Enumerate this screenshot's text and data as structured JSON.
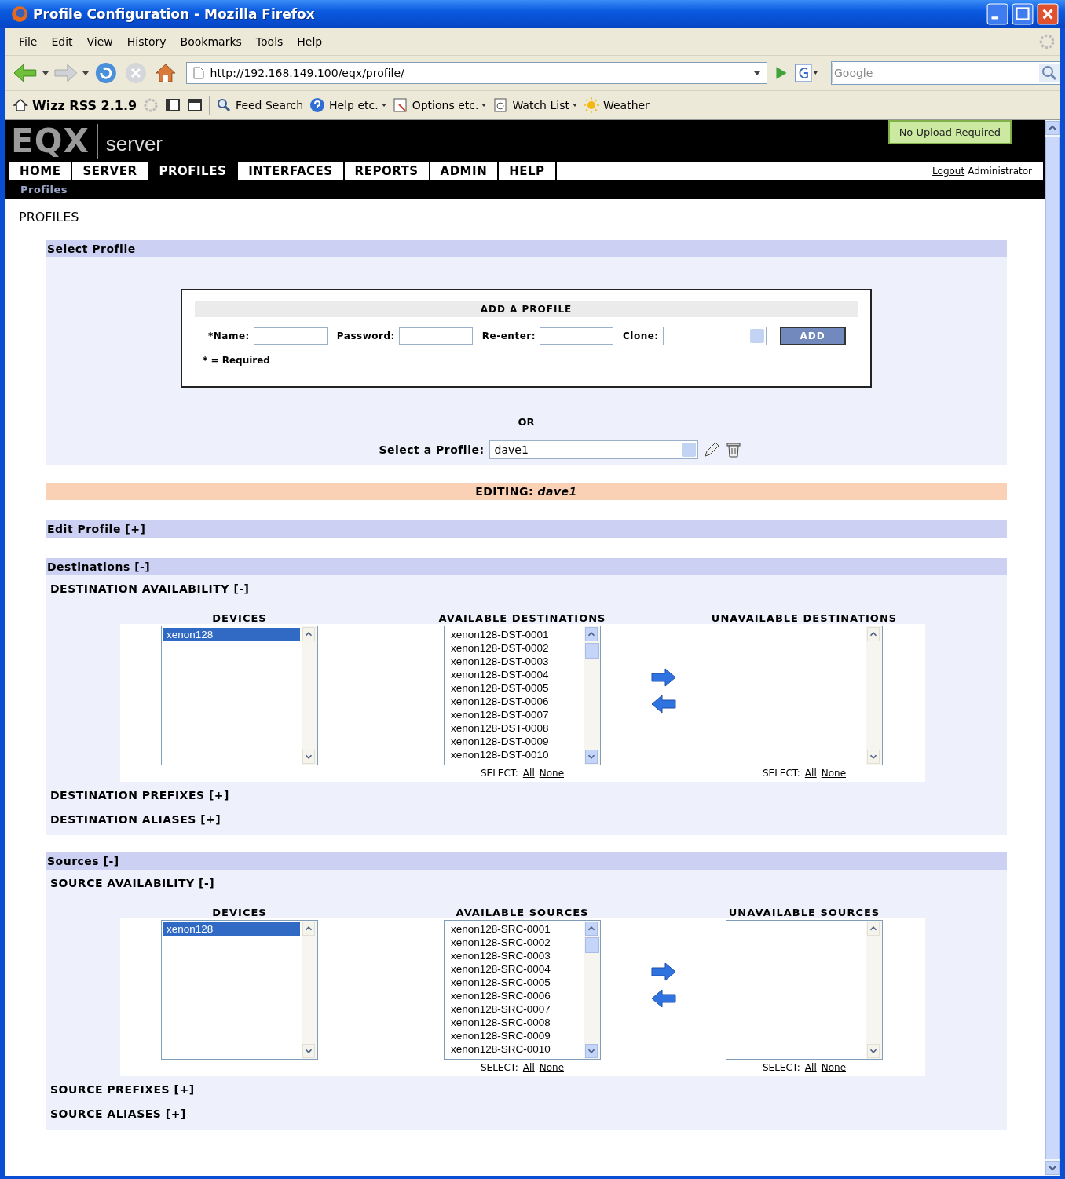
{
  "window": {
    "title": "Profile Configuration - Mozilla Firefox"
  },
  "menu_bar": [
    "File",
    "Edit",
    "View",
    "History",
    "Bookmarks",
    "Tools",
    "Help"
  ],
  "address_bar": {
    "url": "http://192.168.149.100/eqx/profile/"
  },
  "search_box": {
    "placeholder": "Google"
  },
  "bookmarks_toolbar": [
    {
      "label": "Wizz RSS 2.1.9",
      "kind": "rss",
      "dropdown": false
    },
    {
      "label": "Feed Search",
      "kind": "search",
      "dropdown": false
    },
    {
      "label": "Help etc.",
      "kind": "help",
      "dropdown": true
    },
    {
      "label": "Options etc.",
      "kind": "options",
      "dropdown": true
    },
    {
      "label": "Watch List",
      "kind": "watch",
      "dropdown": true
    },
    {
      "label": "Weather",
      "kind": "weather",
      "dropdown": false
    }
  ],
  "header": {
    "logo": "EQX",
    "product": "server",
    "status": "No Upload Required"
  },
  "nav_tabs": [
    {
      "label": "HOME",
      "selected": false
    },
    {
      "label": "SERVER",
      "selected": false
    },
    {
      "label": "PROFILES",
      "selected": true
    },
    {
      "label": "INTERFACES",
      "selected": false
    },
    {
      "label": "REPORTS",
      "selected": false
    },
    {
      "label": "ADMIN",
      "selected": false
    },
    {
      "label": "HELP",
      "selected": false
    }
  ],
  "user_links": {
    "logout": "Logout",
    "user": "Administrator"
  },
  "breadcrumb": "Profiles",
  "page_heading": "PROFILES",
  "select_profile": {
    "title": "Select Profile",
    "add_title": "ADD A PROFILE",
    "fields": [
      {
        "label": "*Name:",
        "kind": "text"
      },
      {
        "label": "Password:",
        "kind": "text"
      },
      {
        "label": "Re-enter:",
        "kind": "text"
      },
      {
        "label": "Clone:",
        "kind": "select"
      }
    ],
    "add_button": "ADD",
    "note": "* = Required",
    "or": "OR",
    "select_label": "Select a Profile:",
    "select_value": "dave1"
  },
  "editing": {
    "label": "EDITING:",
    "profile": "dave1"
  },
  "sections": [
    {
      "title": "Edit Profile [+]"
    },
    {
      "title": "Destinations [-]",
      "subsections": [
        {
          "title": "DESTINATION AVAILABILITY [-]",
          "lists": [
            {
              "heading": "DEVICES",
              "items": [
                {
                  "label": "xenon128",
                  "selected": true
                }
              ]
            },
            {
              "heading": "AVAILABLE DESTINATIONS",
              "select": {
                "label": "SELECT:",
                "all": "All",
                "none": "None"
              },
              "items": [
                {
                  "label": "xenon128-DST-0001",
                  "selected": false
                },
                {
                  "label": "xenon128-DST-0002",
                  "selected": false
                },
                {
                  "label": "xenon128-DST-0003",
                  "selected": false
                },
                {
                  "label": "xenon128-DST-0004",
                  "selected": false
                },
                {
                  "label": "xenon128-DST-0005",
                  "selected": false
                },
                {
                  "label": "xenon128-DST-0006",
                  "selected": false
                },
                {
                  "label": "xenon128-DST-0007",
                  "selected": false
                },
                {
                  "label": "xenon128-DST-0008",
                  "selected": false
                },
                {
                  "label": "xenon128-DST-0009",
                  "selected": false
                },
                {
                  "label": "xenon128-DST-0010",
                  "selected": false
                }
              ]
            },
            {
              "heading": "UNAVAILABLE DESTINATIONS",
              "select": {
                "label": "SELECT:",
                "all": "All",
                "none": "None"
              }
            }
          ]
        },
        {
          "title": "DESTINATION PREFIXES [+]"
        },
        {
          "title": "DESTINATION ALIASES [+]"
        }
      ]
    },
    {
      "title": "Sources [-]",
      "subsections": [
        {
          "title": "SOURCE AVAILABILITY [-]",
          "lists": [
            {
              "heading": "DEVICES",
              "items": [
                {
                  "label": "xenon128",
                  "selected": true
                }
              ]
            },
            {
              "heading": "AVAILABLE SOURCES",
              "select": {
                "label": "SELECT:",
                "all": "All",
                "none": "None"
              },
              "items": [
                {
                  "label": "xenon128-SRC-0001",
                  "selected": false
                },
                {
                  "label": "xenon128-SRC-0002",
                  "selected": false
                },
                {
                  "label": "xenon128-SRC-0003",
                  "selected": false
                },
                {
                  "label": "xenon128-SRC-0004",
                  "selected": false
                },
                {
                  "label": "xenon128-SRC-0005",
                  "selected": false
                },
                {
                  "label": "xenon128-SRC-0006",
                  "selected": false
                },
                {
                  "label": "xenon128-SRC-0007",
                  "selected": false
                },
                {
                  "label": "xenon128-SRC-0008",
                  "selected": false
                },
                {
                  "label": "xenon128-SRC-0009",
                  "selected": false
                },
                {
                  "label": "xenon128-SRC-0010",
                  "selected": false
                }
              ]
            },
            {
              "heading": "UNAVAILABLE SOURCES",
              "select": {
                "label": "SELECT:",
                "all": "All",
                "none": "None"
              }
            }
          ]
        },
        {
          "title": "SOURCE PREFIXES [+]"
        },
        {
          "title": "SOURCE ALIASES [+]"
        }
      ]
    }
  ]
}
